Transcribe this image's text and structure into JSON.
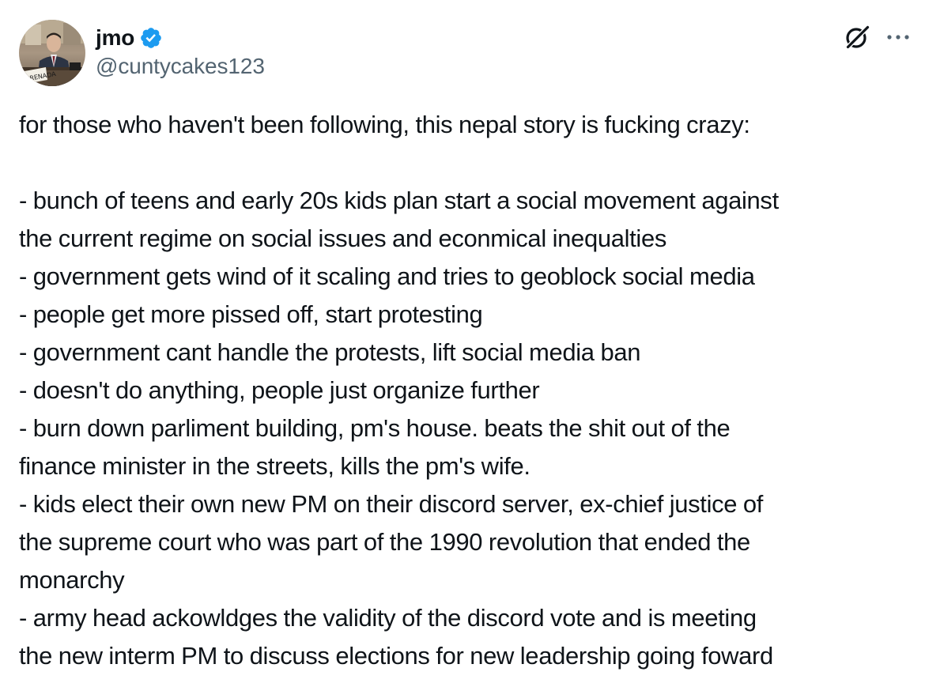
{
  "tweet": {
    "author": {
      "display_name": "jmo",
      "handle": "@cuntycakes123",
      "verified": true,
      "avatar_placard_text": "GRENADA"
    },
    "actions": {
      "grok_icon": "grok-icon",
      "more_icon": "more-icon"
    },
    "text_lines": [
      "for those who haven't been following, this nepal story is fucking crazy:",
      "",
      "- bunch of teens and early 20s kids plan start a social movement against",
      "the current regime on social issues and econmical inequalties",
      "- government gets wind of it scaling and tries to geoblock social media",
      "- people get more pissed off, start protesting",
      "- government cant handle the protests, lift social media ban",
      "- doesn't do anything, people just organize further",
      "- burn down parliment building, pm's house.  beats the shit out of the",
      "finance minister in the streets, kills the pm's wife.",
      "- kids elect their own new PM on their discord server, ex-chief justice of",
      "the supreme court who was part of the 1990 revolution that ended the",
      "monarchy",
      "- army head ackowldges the validity of the discord vote and is meeting",
      "the new interm PM to discuss elections for new leadership going foward"
    ]
  },
  "colors": {
    "text_primary": "#0f1419",
    "text_secondary": "#536471",
    "verified_blue": "#1d9bf0"
  }
}
